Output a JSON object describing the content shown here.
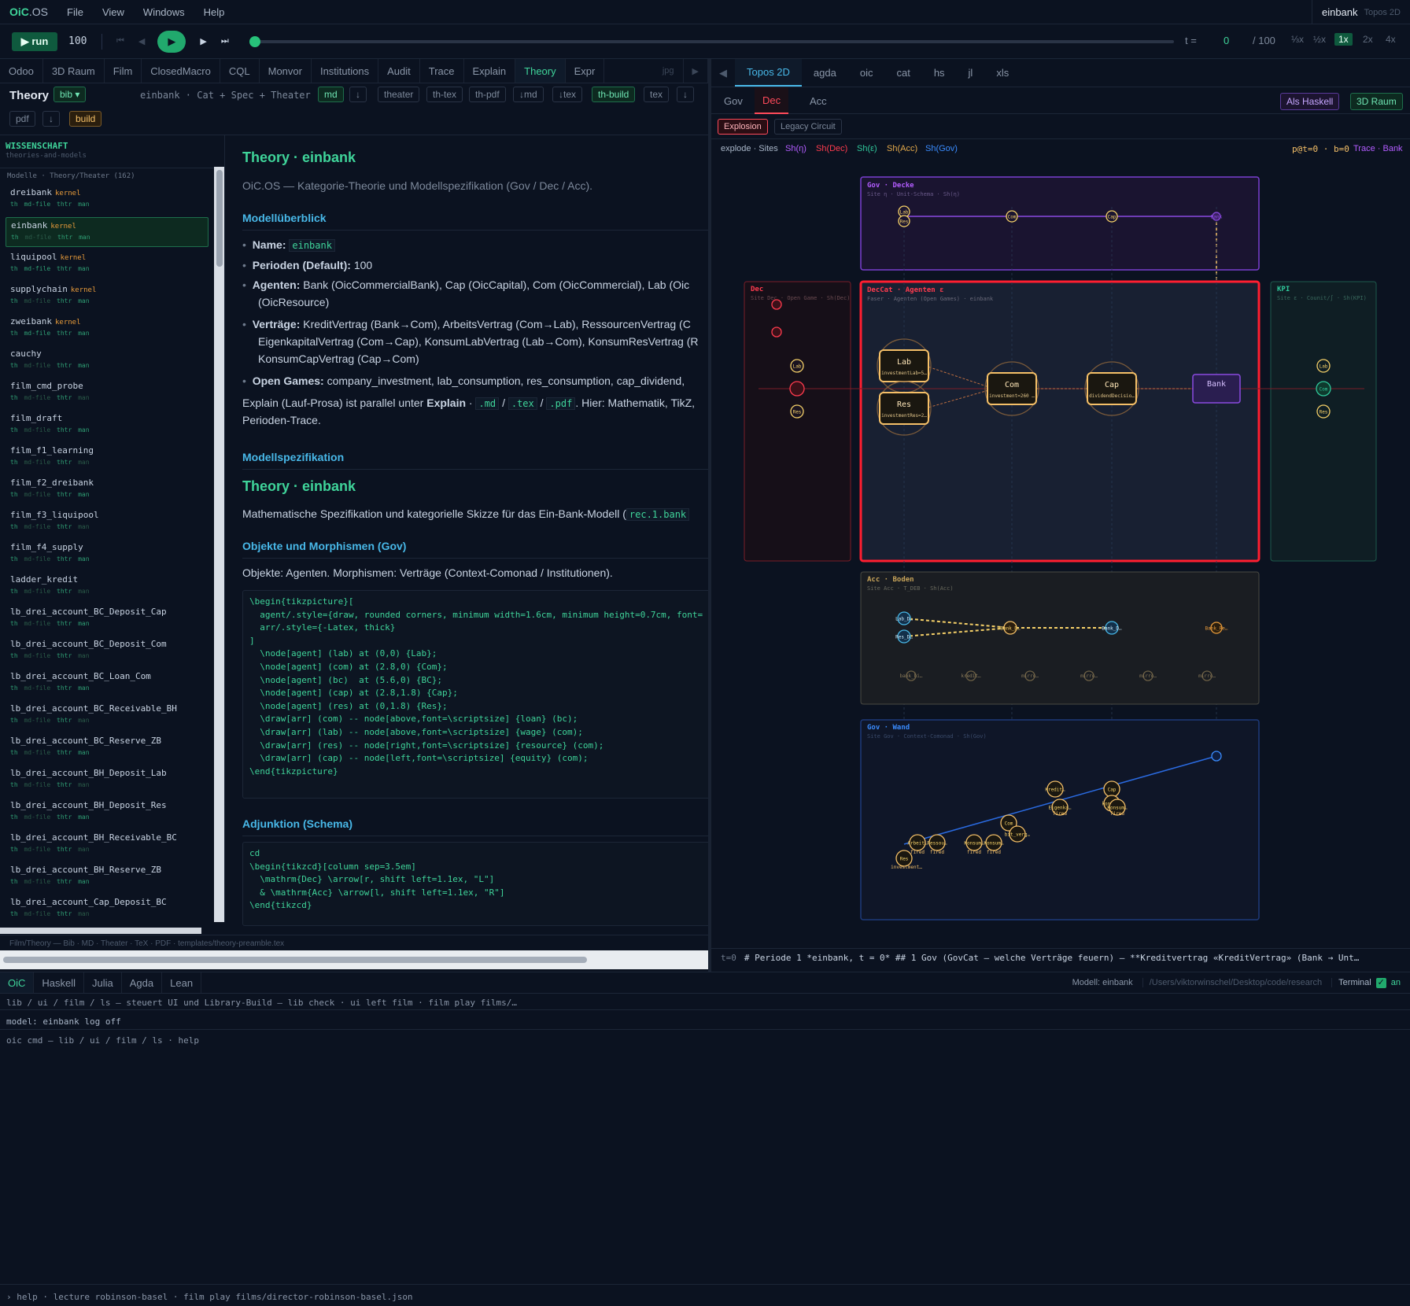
{
  "menubar": {
    "logo_a": "OiC",
    "logo_b": ".OS",
    "menu": [
      "File",
      "View",
      "Windows",
      "Help"
    ],
    "model": "einbank",
    "view": "Topos 2D"
  },
  "transport": {
    "run": "▶ run",
    "steps": "100",
    "t_label": "t =",
    "t_value": "0",
    "t_max": "/ 100",
    "speeds": [
      "⅓x",
      "½x",
      "1x",
      "2x",
      "4x"
    ],
    "active_speed": "1x",
    "progress": 0
  },
  "left_tabs": [
    "Odoo",
    "3D Raum",
    "Film",
    "ClosedMacro",
    "CQL",
    "Monvor",
    "Institutions",
    "Audit",
    "Trace",
    "Explain",
    "Theory",
    "Expr"
  ],
  "left_tabs_active": "Theory",
  "left_tabs_extra": "jpg",
  "theory_bar": {
    "title": "Theory",
    "bib": "bib ▾",
    "path": "einbank · Cat + Spec + Theater",
    "md": "md",
    "down1": "↓",
    "theater": "theater",
    "thtex": "th-tex",
    "thpdf": "th-pdf",
    "dmd": "↓md",
    "dtex": "↓tex",
    "thbuild": "th-build",
    "tex": "tex",
    "down2": "↓",
    "pdf": "pdf",
    "down3": "↓",
    "build": "build"
  },
  "sidebar": {
    "heading": "WISSENSCHAFT",
    "subheading": "theories-and-models",
    "section": "Modelle · Theory/Theater (162)",
    "tags": {
      "th": "th",
      "md": "md-file",
      "thtr": "thtr",
      "man": "man"
    },
    "items": [
      {
        "name": "dreibank",
        "kernel": "kernel"
      },
      {
        "name": "einbank",
        "kernel": "kernel"
      },
      {
        "name": "liquipool",
        "kernel": "kernel"
      },
      {
        "name": "supplychain",
        "kernel": "kernel"
      },
      {
        "name": "zweibank",
        "kernel": "kernel"
      },
      {
        "name": "cauchy",
        "kernel": ""
      },
      {
        "name": "film_cmd_probe",
        "kernel": ""
      },
      {
        "name": "film_draft",
        "kernel": ""
      },
      {
        "name": "film_f1_learning",
        "kernel": ""
      },
      {
        "name": "film_f2_dreibank",
        "kernel": ""
      },
      {
        "name": "film_f3_liquipool",
        "kernel": ""
      },
      {
        "name": "film_f4_supply",
        "kernel": ""
      },
      {
        "name": "ladder_kredit",
        "kernel": ""
      },
      {
        "name": "lb_drei_account_BC_Deposit_Cap",
        "kernel": ""
      },
      {
        "name": "lb_drei_account_BC_Deposit_Com",
        "kernel": ""
      },
      {
        "name": "lb_drei_account_BC_Loan_Com",
        "kernel": ""
      },
      {
        "name": "lb_drei_account_BC_Receivable_BH",
        "kernel": ""
      },
      {
        "name": "lb_drei_account_BC_Reserve_ZB",
        "kernel": ""
      },
      {
        "name": "lb_drei_account_BH_Deposit_Lab",
        "kernel": ""
      },
      {
        "name": "lb_drei_account_BH_Deposit_Res",
        "kernel": ""
      },
      {
        "name": "lb_drei_account_BH_Receivable_BC",
        "kernel": ""
      },
      {
        "name": "lb_drei_account_BH_Reserve_ZB",
        "kernel": ""
      },
      {
        "name": "lb_drei_account_Cap_Deposit_BC",
        "kernel": ""
      }
    ],
    "selected": "einbank"
  },
  "content": {
    "title1": "Theory · einbank",
    "subtitle": "OiC.OS — Kategorie-Theorie und Modellspezifikation (Gov / Dec / Acc).",
    "h_overview": "Modellüberblick",
    "name_label": "Name:",
    "name_value": "einbank",
    "periods_label": "Perioden (Default):",
    "periods_value": "100",
    "agents_label": "Agenten:",
    "agents_line1": "Bank (OicCommercialBank), Cap (OicCapital), Com (OicCommercial), Lab (Oic",
    "agents_line2": "(OicResource)",
    "contracts_label": "Verträge:",
    "contracts_line1": "KreditVertrag (Bank→Com), ArbeitsVertrag (Com→Lab), RessourcenVertrag (C",
    "contracts_line2": "EigenkapitalVertrag (Com→Cap), KonsumLabVertrag (Lab→Com), KonsumResVertrag (R",
    "contracts_line3": "KonsumCapVertrag (Cap→Com)",
    "games_label": "Open Games:",
    "games_value": "company_investment, lab_consumption, res_consumption, cap_dividend,",
    "explain_a": "Explain (Lauf-Prosa) ist parallel unter",
    "explain_b": "Explain",
    "explain_c": " · ",
    "ext_md": ".md",
    "slash": "/",
    "ext_tex": ".tex",
    "ext_pdf": ".pdf",
    "explain_d": ". Hier: Mathematik, TikZ,",
    "explain_e": "Perioden-Trace.",
    "h_spec": "Modellspezifikation",
    "title2": "Theory · einbank",
    "spec_text": "Mathematische Spezifikation und kategorielle Skizze für das Ein-Bank-Modell (",
    "spec_code": "rec.1.bank",
    "h_objects": "Objekte und Morphismen (Gov)",
    "objects_text": "Objekte: Agenten. Morphismen: Verträge (Context-Comonad / Institutionen).",
    "tikz": "\\begin{tikzpicture}[\n  agent/.style={draw, rounded corners, minimum width=1.6cm, minimum height=0.7cm, font=\n  arr/.style={-Latex, thick}\n]\n  \\node[agent] (lab) at (0,0) {Lab};\n  \\node[agent] (com) at (2.8,0) {Com};\n  \\node[agent] (bc)  at (5.6,0) {BC};\n  \\node[agent] (cap) at (2.8,1.8) {Cap};\n  \\node[agent] (res) at (0,1.8) {Res};\n  \\draw[arr] (com) -- node[above,font=\\scriptsize] {loan} (bc);\n  \\draw[arr] (lab) -- node[above,font=\\scriptsize] {wage} (com);\n  \\draw[arr] (res) -- node[right,font=\\scriptsize] {resource} (com);\n  \\draw[arr] (cap) -- node[left,font=\\scriptsize] {equity} (com);\n\\end{tikzpicture}",
    "h_adjunction": "Adjunktion (Schema)",
    "tikzcd": "cd\n\\begin{tikzcd}[column sep=3.5em]\n  \\mathrm{Dec} \\arrow[r, shift left=1.1ex, \"L\"]\n  & \\mathrm{Acc} \\arrow[l, shift left=1.1ex, \"R\"]\n\\end{tikzcd}",
    "footer": "Film/Theory — Bib · MD · Theater · TeX · PDF · templates/theory-preamble.tex"
  },
  "right_tabs": [
    "Topos 2D",
    "agda",
    "oic",
    "cat",
    "hs",
    "jl",
    "xls"
  ],
  "right_active": "Topos 2D",
  "right_arrow": "◀",
  "sub_tabs": [
    "Gov",
    "Dec",
    "Acc"
  ],
  "sub_active": "Dec",
  "btn_haskell": "Als Haskell",
  "btn_3d": "3D Raum",
  "mode": {
    "explosion": "Explosion",
    "legacy": "Legacy Circuit"
  },
  "sites_bar": {
    "prefix": "explode · Sites",
    "sites": [
      {
        "t": "Sh(η)",
        "c": "#b35cff"
      },
      {
        "t": "Sh(Dec)",
        "c": "#ff3b4e"
      },
      {
        "t": "Sh(ε)",
        "c": "#2fc79a"
      },
      {
        "t": "Sh(Acc)",
        "c": "#e3a94a"
      },
      {
        "t": "Sh(Gov)",
        "c": "#3a8cff"
      }
    ],
    "pt": "p@t=0 · b=0",
    "trace": "Trace · Bank"
  },
  "diagram": {
    "gov_top": {
      "title": "Gov · Decke",
      "sub": "Site η · Unit-Schema · Sh(η)",
      "nodes": [
        "Lab",
        "Res",
        "Com",
        "Cap",
        "Bank"
      ]
    },
    "dec": {
      "title": "Dec",
      "sub": "Site Dec · Open Game · Sh(Dec)",
      "nodes": [
        "Lab",
        "Res"
      ]
    },
    "deccat": {
      "title": "DecCat · Agenten ε",
      "sub": "Faser · Agenten (Open Games) · einbank",
      "agents": [
        {
          "name": "Lab",
          "detail": "investmentLab=5…"
        },
        {
          "name": "Res",
          "detail": "investmentRes=2…"
        },
        {
          "name": "Com",
          "detail": "investment=260 …"
        },
        {
          "name": "Cap",
          "detail": "dividendDecisio…"
        },
        {
          "name": "Bank",
          "detail": ""
        }
      ]
    },
    "kpi": {
      "title": "KPI",
      "sub": "Site ε · Counit/∫ · Sh(KPI)",
      "nodes": [
        "Lab",
        "Com",
        "Res"
      ]
    },
    "acc": {
      "title": "Acc · Boden",
      "sub": "Site Acc · T_DEB · Sh(Acc)",
      "nodes": [
        "Lab_D…",
        "Res_D…",
        "Bank_D…",
        "Bank_D…",
        "Bank_Re…"
      ],
      "bottom": [
        "bank_bi…",
        "kredit…",
        "mirro…",
        "mirro…",
        "mirro…",
        "mirro…"
      ]
    },
    "gov_wall": {
      "title": "Gov · Wand",
      "sub": "Site Gov · Context-Comonad · Sh(Gov)",
      "labels": [
        "Kredit…",
        "Eigenka…",
        "Cap",
        "konsum…",
        "Konsum…",
        "Com",
        "bit_verg…",
        "Arbeit…",
        "Ressou…",
        "Konsum…",
        "Konsum…",
        "Res",
        "investment…"
      ],
      "fired": "fired"
    }
  },
  "statusline": {
    "t": "t=0",
    "text": "# Periode 1 *einbank, t = 0* ## 1 Gov (GovCat — welche Verträge feuern) — **Kreditvertrag «KreditVertrag» (Bank → Unt…"
  },
  "terminal": {
    "tabs": [
      "OiC",
      "Haskell",
      "Julia",
      "Agda",
      "Lean"
    ],
    "active": "OiC",
    "model": "Modell: einbank",
    "path": "/Users/viktorwinschel/Desktop/code/research",
    "term_label": "Terminal",
    "term_on": "an",
    "line1": "lib / ui / film / ls — steuert UI und Library-Build — lib check · ui left film · film play films/…",
    "line2": "model: einbank  log off",
    "line3": "oic cmd — lib / ui / film / ls · help"
  },
  "bottom_hint": "› help · lecture robinson-basel · film play films/director-robinson-basel.json"
}
